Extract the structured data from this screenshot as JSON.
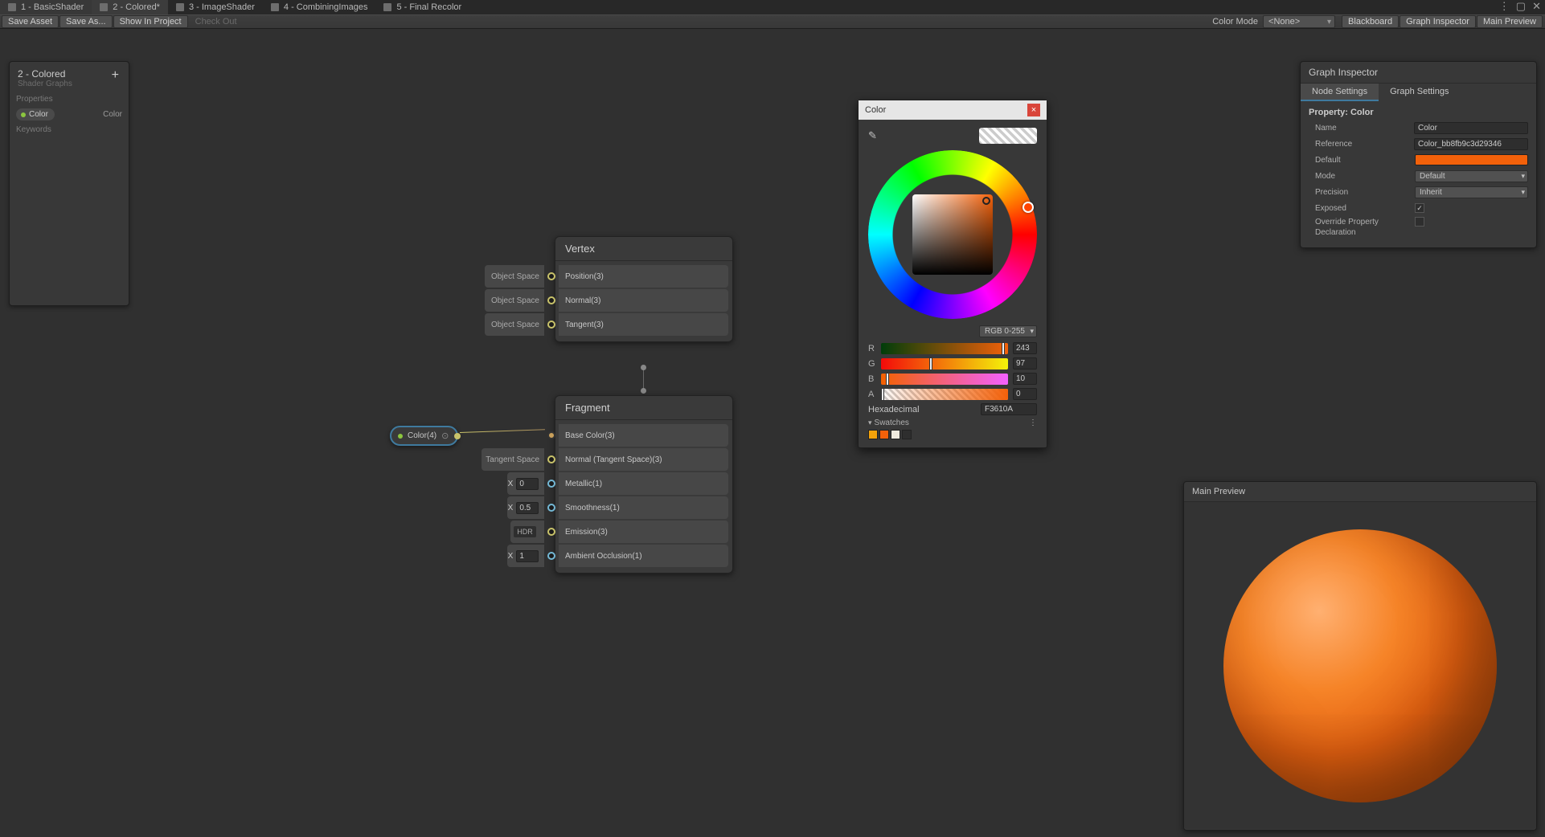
{
  "tabs": [
    {
      "label": "1 - BasicShader"
    },
    {
      "label": "2 - Colored*"
    },
    {
      "label": "3 - ImageShader"
    },
    {
      "label": "4 - CombiningImages"
    },
    {
      "label": "5 - Final Recolor"
    }
  ],
  "toolbar": {
    "save_asset": "Save Asset",
    "save_as": "Save As...",
    "show_in_project": "Show In Project",
    "check_out": "Check Out",
    "color_mode_label": "Color Mode",
    "color_mode_value": "<None>",
    "blackboard": "Blackboard",
    "graph_inspector": "Graph Inspector",
    "main_preview": "Main Preview"
  },
  "blackboard": {
    "title": "2 - Colored",
    "subtitle": "Shader Graphs",
    "properties_label": "Properties",
    "keywords_label": "Keywords",
    "props": [
      {
        "name": "Color",
        "type": "Color"
      }
    ]
  },
  "nodes": {
    "vertex": {
      "title": "Vertex",
      "slots": [
        {
          "tag": "Object Space",
          "label": "Position(3)",
          "port": "v3"
        },
        {
          "tag": "Object Space",
          "label": "Normal(3)",
          "port": "v3"
        },
        {
          "tag": "Object Space",
          "label": "Tangent(3)",
          "port": "v3"
        }
      ]
    },
    "fragment": {
      "title": "Fragment",
      "slots": [
        {
          "tag": "",
          "label": "Base Color(3)",
          "port": "c",
          "kind": "none"
        },
        {
          "tag": "Tangent Space",
          "label": "Normal (Tangent Space)(3)",
          "port": "v3",
          "kind": "tag"
        },
        {
          "tag_x": "X",
          "tag_val": "0",
          "label": "Metallic(1)",
          "port": "v1",
          "kind": "xval"
        },
        {
          "tag_x": "X",
          "tag_val": "0.5",
          "label": "Smoothness(1)",
          "port": "v1",
          "kind": "xval"
        },
        {
          "tag_hdr": "HDR",
          "label": "Emission(3)",
          "port": "v3",
          "kind": "hdr"
        },
        {
          "tag_x": "X",
          "tag_val": "1",
          "label": "Ambient Occlusion(1)",
          "port": "v1",
          "kind": "xval"
        }
      ]
    },
    "color_prop": {
      "label": "Color(4)"
    }
  },
  "color_picker": {
    "title": "Color",
    "rgb_mode": "RGB 0-255",
    "channels": {
      "r": {
        "label": "R",
        "value": "243",
        "pct": 95
      },
      "g": {
        "label": "G",
        "value": "97",
        "pct": 38
      },
      "b": {
        "label": "B",
        "value": "10",
        "pct": 4
      },
      "a": {
        "label": "A",
        "value": "0",
        "pct": 0
      }
    },
    "hex_label": "Hexadecimal",
    "hex_value": "F3610A",
    "swatches_label": "Swatches",
    "swatches": [
      "#f3a20a",
      "#f3610a",
      "#efeade",
      "#2e2e2e"
    ],
    "accent": "#f3610a"
  },
  "inspector": {
    "title": "Graph Inspector",
    "tabs": {
      "node": "Node Settings",
      "graph": "Graph Settings"
    },
    "property_heading": "Property: Color",
    "fields": {
      "name_label": "Name",
      "name_value": "Color",
      "reference_label": "Reference",
      "reference_value": "Color_bb8fb9c3d29346",
      "default_label": "Default",
      "mode_label": "Mode",
      "mode_value": "Default",
      "precision_label": "Precision",
      "precision_value": "Inherit",
      "exposed_label": "Exposed",
      "override_label_1": "Override Property",
      "override_label_2": "Declaration"
    }
  },
  "preview": {
    "title": "Main Preview"
  }
}
